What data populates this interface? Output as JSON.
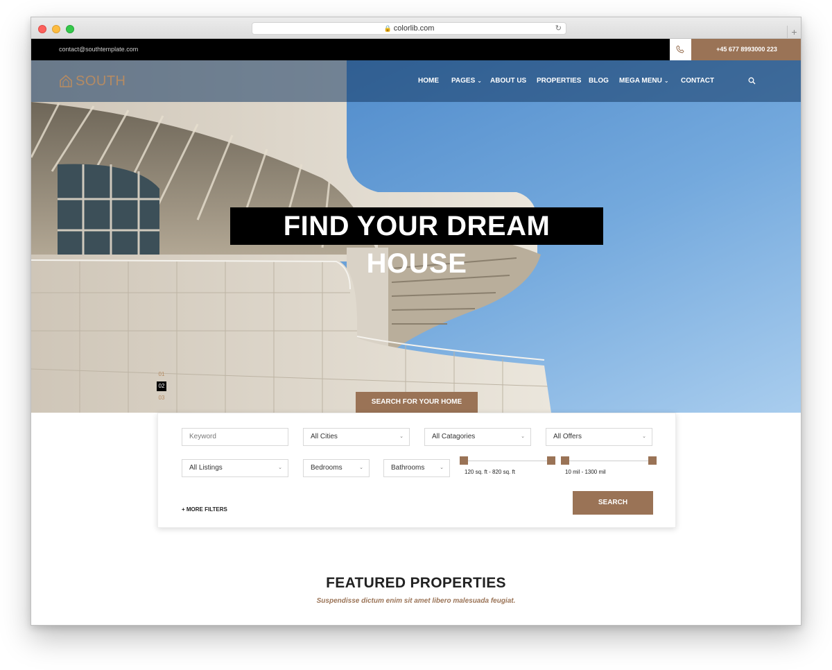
{
  "browser": {
    "url": "colorlib.com",
    "new_tab_label": "+"
  },
  "topbar": {
    "email": "contact@southtemplate.com",
    "phone": "+45 677 8993000 223"
  },
  "brand": {
    "name": "SOUTH",
    "accent_color": "#9a7356"
  },
  "nav": {
    "home": "HOME",
    "pages": "PAGES",
    "about": "ABOUT US",
    "properties": "PROPERTIES",
    "blog": "BLOG",
    "mega_menu": "MEGA MENU",
    "contact": "CONTACT"
  },
  "hero": {
    "headline": "FIND YOUR DREAM HOUSE",
    "slides": [
      "01",
      "02",
      "03"
    ],
    "active_slide": "02",
    "search_tab": "SEARCH FOR YOUR HOME"
  },
  "search": {
    "keyword_placeholder": "Keyword",
    "cities": "All Cities",
    "categories": "All Catagories",
    "offers": "All Offers",
    "listings": "All Listings",
    "bedrooms": "Bedrooms",
    "bathrooms": "Bathrooms",
    "area_range": "120 sq. ft - 820 sq. ft",
    "price_range": "10 mil - 1300 mil",
    "more_filters": "+ MORE FILTERS",
    "search_button": "SEARCH"
  },
  "featured": {
    "title": "FEATURED PROPERTIES",
    "subtitle": "Suspendisse dictum enim sit amet libero malesuada feugiat."
  }
}
